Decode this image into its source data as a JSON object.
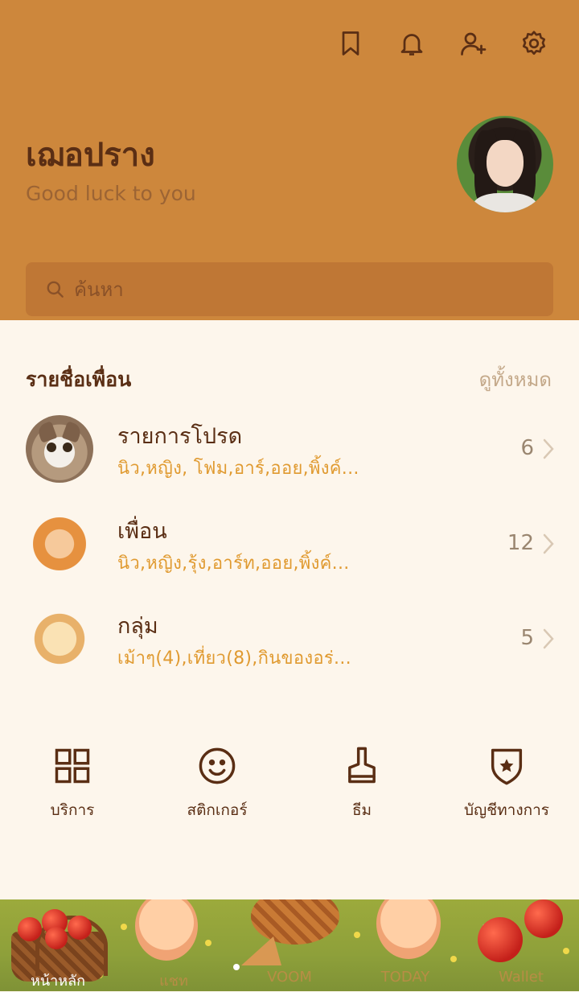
{
  "header": {
    "icons": [
      "bookmark-icon",
      "bell-icon",
      "add-friend-icon",
      "settings-icon"
    ],
    "profile_name": "เฌอปราง",
    "status_message": "Good luck to you",
    "search_placeholder": "ค้นหา"
  },
  "friends_section": {
    "title": "รายชื่อเพื่อน",
    "see_all": "ดูทั้งหมด",
    "rows": [
      {
        "name": "รายการโปรด",
        "members": "นิว,หญิง, โฟม,อาร์,ออย,พิ้งค์...",
        "count": "6"
      },
      {
        "name": "เพื่อน",
        "members": "นิว,หญิง,รุ้ง,อาร์ท,ออย,พิ้งค์...",
        "count": "12"
      },
      {
        "name": "กลุ่ม",
        "members": "เม้าๆ(4),เที่ยว(8),กินของอร่...",
        "count": "5"
      }
    ]
  },
  "quick_actions": [
    {
      "label": "บริการ",
      "icon": "grid-icon"
    },
    {
      "label": "สติกเกอร์",
      "icon": "smiley-icon"
    },
    {
      "label": "ธีม",
      "icon": "brush-icon"
    },
    {
      "label": "บัญชีทางการ",
      "icon": "shield-star-icon"
    }
  ],
  "bottom_nav": [
    "หน้าหลัก",
    "แชท",
    "VOOM",
    "TODAY",
    "Wallet"
  ],
  "colors": {
    "header_bg": "#cd873c",
    "body_bg": "#fdf6ec",
    "text_dark": "#5a2e14",
    "accent": "#e09a30"
  }
}
